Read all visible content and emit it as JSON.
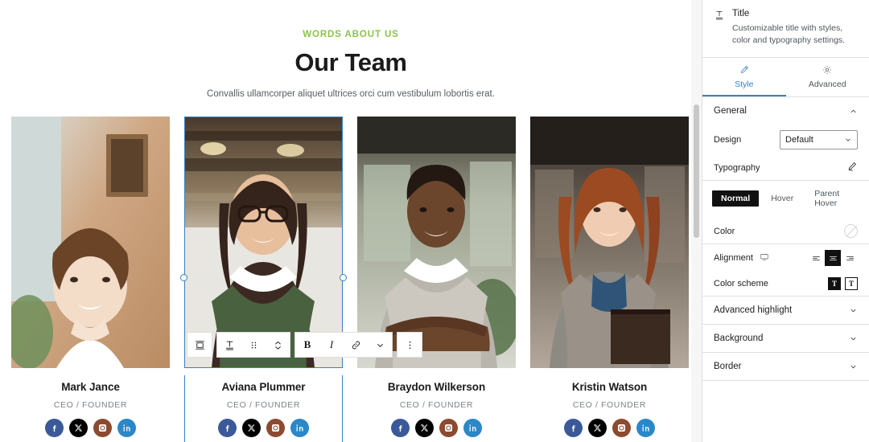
{
  "canvas": {
    "eyebrow": "WORDS ABOUT US",
    "title": "Our Team",
    "subtitle": "Convallis ullamcorper aliquet ultrices orci cum vestibulum lobortis erat.",
    "members": [
      {
        "name": "Mark Jance",
        "role": "CEO / FOUNDER",
        "selected": false,
        "socials": [
          "facebook-icon",
          "x-twitter-icon",
          "instagram-icon",
          "linkedin-icon"
        ]
      },
      {
        "name": "Aviana Plummer",
        "role": "CEO / FOUNDER",
        "selected": true,
        "socials": [
          "facebook-icon",
          "x-twitter-icon",
          "instagram-icon",
          "linkedin-icon"
        ]
      },
      {
        "name": "Braydon Wilkerson",
        "role": "CEO / FOUNDER",
        "selected": false,
        "socials": [
          "facebook-icon",
          "x-twitter-icon",
          "instagram-icon",
          "linkedin-icon"
        ]
      },
      {
        "name": "Kristin Watson",
        "role": "CEO / FOUNDER",
        "selected": false,
        "socials": [
          "facebook-icon",
          "x-twitter-icon",
          "instagram-icon",
          "linkedin-icon"
        ]
      }
    ],
    "social_colors": {
      "facebook": "#3b5998",
      "x": "#000000",
      "instagram": "#8c4a2f",
      "linkedin": "#2a87c8"
    }
  },
  "block_toolbar": {
    "buttons": [
      {
        "name": "block-type-transform",
        "icon": "block-transform-icon",
        "label": ""
      },
      {
        "name": "title-block-icon",
        "icon": "title-icon",
        "label": ""
      },
      {
        "name": "drag-handle",
        "icon": "drag-dots-icon",
        "label": ""
      },
      {
        "name": "move-updown",
        "icon": "move-up-down-icon",
        "label": ""
      },
      {
        "name": "bold-button",
        "icon": "bold-icon",
        "label": "B"
      },
      {
        "name": "italic-button",
        "icon": "italic-icon",
        "label": "I"
      },
      {
        "name": "link-button",
        "icon": "link-icon",
        "label": ""
      },
      {
        "name": "more-rich-text",
        "icon": "chevron-down-icon",
        "label": ""
      },
      {
        "name": "block-options",
        "icon": "vertical-ellipsis-icon",
        "label": ""
      }
    ]
  },
  "sidebar": {
    "header": {
      "icon": "title-icon",
      "title": "Title",
      "description": "Customizable title with styles, color and typography settings."
    },
    "tabs": [
      {
        "label": "Style",
        "icon": "brush-icon",
        "active": true
      },
      {
        "label": "Advanced",
        "icon": "gear-icon",
        "active": false
      }
    ],
    "general": {
      "label": "General",
      "expanded": true,
      "design": {
        "label": "Design",
        "value": "Default"
      },
      "typography": {
        "label": "Typography",
        "icon": "pencil-icon"
      }
    },
    "state_tabs": [
      {
        "label": "Normal",
        "active": true
      },
      {
        "label": "Hover",
        "active": false
      },
      {
        "label": "Parent Hover",
        "active": false
      }
    ],
    "color": {
      "label": "Color",
      "value": "none",
      "swatch_icon": "no-color-icon"
    },
    "alignment": {
      "label": "Alignment",
      "device_icon": "monitor-icon",
      "options": [
        {
          "name": "align-left",
          "active": false
        },
        {
          "name": "align-center",
          "active": true
        },
        {
          "name": "align-right",
          "active": false
        }
      ]
    },
    "color_scheme": {
      "label": "Color scheme",
      "options": [
        {
          "name": "scheme-dark",
          "label": "T",
          "active": true
        },
        {
          "name": "scheme-light",
          "label": "T",
          "active": false
        }
      ]
    },
    "sections": [
      {
        "label": "Advanced highlight",
        "expanded": false
      },
      {
        "label": "Background",
        "expanded": false
      },
      {
        "label": "Border",
        "expanded": false
      }
    ],
    "accent_color": "#3582c4"
  }
}
